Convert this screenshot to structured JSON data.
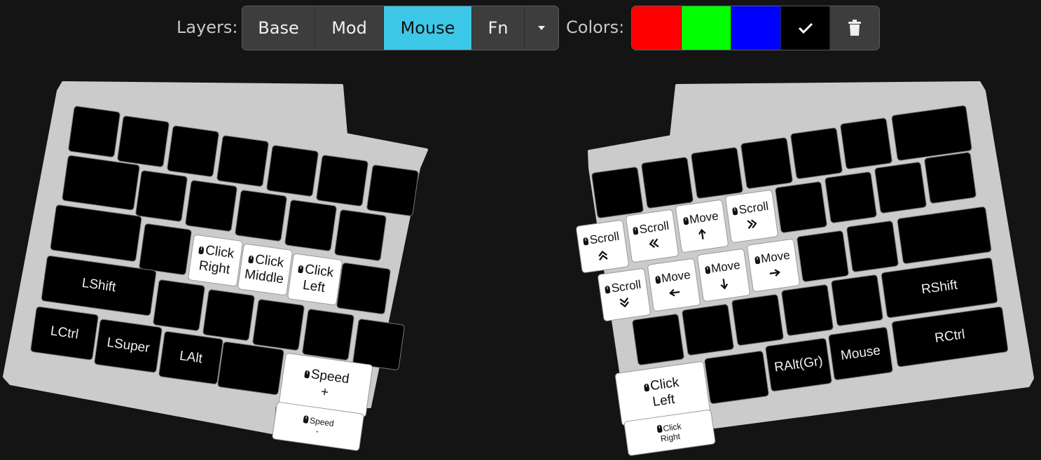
{
  "toolbar": {
    "layers_label": "Layers:",
    "layers": [
      "Base",
      "Mod",
      "Mouse",
      "Fn"
    ],
    "active_layer": "Mouse",
    "colors_label": "Colors:",
    "colors": [
      "#ff0000",
      "#00ff00",
      "#0000ff",
      "#000000"
    ],
    "selected_color": "#000000",
    "accent": "#3ec8e8"
  },
  "left": {
    "row0": [
      "",
      "",
      "",
      "",
      "",
      "",
      ""
    ],
    "row1": [
      "",
      "",
      "",
      "",
      "",
      "",
      ""
    ],
    "row2": [
      "",
      "",
      "",
      "",
      "",
      "",
      ""
    ],
    "row3": [
      "",
      "",
      "",
      "",
      "",
      "",
      ""
    ],
    "lshift": "LShift",
    "lctrl": "LCtrl",
    "lsuper": "LSuper",
    "lalt": "LAlt",
    "click_right": [
      "Click",
      "Right"
    ],
    "click_middle": [
      "Click",
      "Middle"
    ],
    "click_left": [
      "Click",
      "Left"
    ],
    "speed_plus": [
      "Speed",
      "+"
    ],
    "speed_minus": [
      "Speed",
      "-"
    ]
  },
  "right": {
    "scroll_up": "Scroll",
    "scroll_left": "Scroll",
    "move_up": "Move",
    "scroll_right": "Scroll",
    "scroll_down": "Scroll",
    "move_left": "Move",
    "move_down": "Move",
    "move_right": "Move",
    "rshift": "RShift",
    "ralt": "RAlt(Gr)",
    "mouse": "Mouse",
    "rctrl": "RCtrl",
    "click_left": [
      "Click",
      "Left"
    ],
    "click_right": [
      "Click",
      "Right"
    ]
  }
}
